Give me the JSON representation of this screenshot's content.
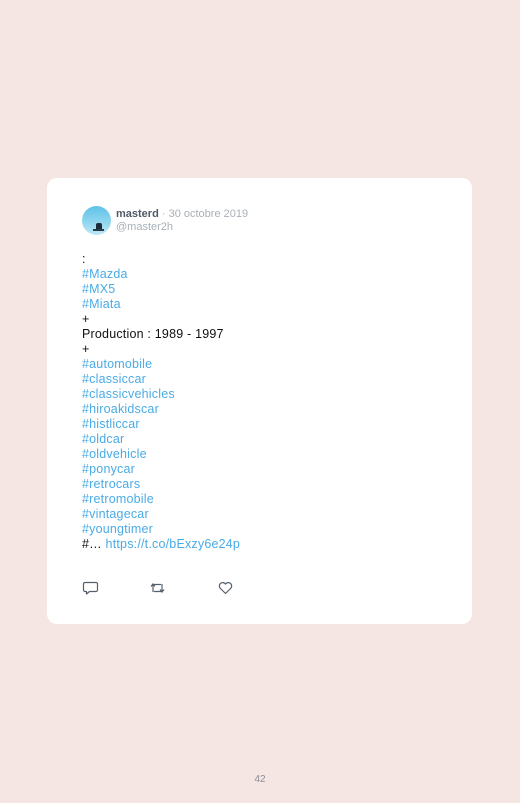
{
  "tweet": {
    "author_name": "masterd",
    "separator": " · ",
    "date": "30 octobre 2019",
    "handle": "@master2h",
    "lines": [
      {
        "text": ":",
        "tag": false
      },
      {
        "text": "#Mazda",
        "tag": true
      },
      {
        "text": "#MX5",
        "tag": true
      },
      {
        "text": "#Miata",
        "tag": true
      },
      {
        "text": "+",
        "tag": false
      },
      {
        "text": "Production : 1989 - 1997",
        "tag": false
      },
      {
        "text": "+",
        "tag": false
      },
      {
        "text": "#automobile",
        "tag": true
      },
      {
        "text": "#classiccar",
        "tag": true
      },
      {
        "text": "#classicvehicles",
        "tag": true
      },
      {
        "text": "#hiroakidscar",
        "tag": true
      },
      {
        "text": "#histliccar",
        "tag": true
      },
      {
        "text": "#oldcar",
        "tag": true
      },
      {
        "text": "#oldvehicle",
        "tag": true
      },
      {
        "text": "#ponycar",
        "tag": true
      },
      {
        "text": "#retrocars",
        "tag": true
      },
      {
        "text": "#retromobile",
        "tag": true
      },
      {
        "text": "#vintagecar",
        "tag": true
      },
      {
        "text": "#youngtimer",
        "tag": true
      }
    ],
    "truncated_prefix": "#…",
    "link": "https://t.co/bExzy6e24p",
    "actions": [
      {
        "name": "reply-icon"
      },
      {
        "name": "retweet-icon"
      },
      {
        "name": "like-icon"
      }
    ]
  },
  "page_number": "42",
  "colors": {
    "background": "#f5e6e3",
    "card": "#ffffff",
    "hashtag": "#4aabe6",
    "muted": "#a8b0b8"
  }
}
